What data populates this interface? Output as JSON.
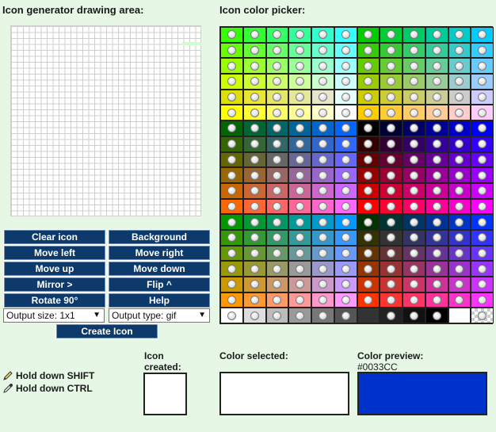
{
  "headings": {
    "drawing_area": "Icon generator drawing area:",
    "color_picker": "Icon color picker:"
  },
  "buttons": {
    "clear_icon": "Clear icon",
    "background": "Background",
    "move_left": "Move left",
    "move_right": "Move right",
    "move_up": "Move up",
    "move_down": "Move down",
    "mirror": "Mirror >",
    "flip": "Flip ^",
    "rotate": "Rotate 90°",
    "help": "Help",
    "create_icon": "Create Icon"
  },
  "selects": {
    "output_size": "Output size: 1x1",
    "output_type": "Output type: gif"
  },
  "hints": {
    "shift": "Hold down SHIFT",
    "ctrl": "Hold down CTRL"
  },
  "preview": {
    "icon_created_label": "Icon created:",
    "color_selected_label": "Color selected:",
    "color_preview_label": "Color preview:",
    "color_preview_value": "#0033CC"
  },
  "colors": {
    "page_bg": "#E6F7E6",
    "button_bg": "#0D3A6B",
    "preview_color": "#0033CC"
  },
  "palette": [
    [
      "#33FF00",
      "#33FF33",
      "#33FF66",
      "#33FF99",
      "#33FFCC",
      "#33FFFF",
      "#00CC00",
      "#00CC33",
      "#00CC66",
      "#00CC99",
      "#00CCCC",
      "#00CCFF"
    ],
    [
      "#66FF00",
      "#66FF33",
      "#66FF66",
      "#66FF99",
      "#66FFCC",
      "#66FFFF",
      "#33CC00",
      "#33CC33",
      "#33CC66",
      "#33CC99",
      "#33CCCC",
      "#33CCFF"
    ],
    [
      "#99FF00",
      "#99FF33",
      "#99FF66",
      "#99FF99",
      "#99FFCC",
      "#99FFFF",
      "#66CC00",
      "#66CC33",
      "#66CC66",
      "#66CC99",
      "#66CCCC",
      "#66CCFF"
    ],
    [
      "#CCFF00",
      "#CCFF33",
      "#CCFF66",
      "#CCFF99",
      "#CCFFCC",
      "#CCFFFF",
      "#99CC00",
      "#99CC33",
      "#99CC66",
      "#99CC99",
      "#99CCCC",
      "#99CCFF"
    ],
    [
      "#DDE000",
      "#E6E633",
      "#E6E666",
      "#E6E699",
      "#E6E6CC",
      "#E6FFFF",
      "#CCCC00",
      "#CCCC33",
      "#CCCC66",
      "#CCCC99",
      "#CCCCCC",
      "#CCCCFF"
    ],
    [
      "#FFFF00",
      "#FFFF33",
      "#FFFF66",
      "#FFFF99",
      "#FFFFCC",
      "#FFFFFF",
      "#FFCC00",
      "#FFCC33",
      "#FFCC66",
      "#FFCC99",
      "#FFCCCC",
      "#FFCCFF"
    ],
    [
      "#006600",
      "#006633",
      "#006666",
      "#006699",
      "#0066CC",
      "#0066FF",
      "#000000",
      "#000033",
      "#000066",
      "#000099",
      "#0000CC",
      "#0000FF"
    ],
    [
      "#336600",
      "#336633",
      "#336666",
      "#336699",
      "#3366CC",
      "#3366FF",
      "#330000",
      "#330033",
      "#330066",
      "#330099",
      "#3300CC",
      "#3300FF"
    ],
    [
      "#666600",
      "#666633",
      "#666666",
      "#666699",
      "#6666CC",
      "#6666FF",
      "#660000",
      "#660033",
      "#660066",
      "#660099",
      "#6600CC",
      "#6600FF"
    ],
    [
      "#996600",
      "#996633",
      "#996666",
      "#996699",
      "#9966CC",
      "#9966FF",
      "#990000",
      "#990033",
      "#990066",
      "#990099",
      "#9900CC",
      "#9900FF"
    ],
    [
      "#CC6600",
      "#CC6633",
      "#CC6666",
      "#CC6699",
      "#CC66CC",
      "#CC66FF",
      "#CC0000",
      "#CC0033",
      "#CC0066",
      "#CC0099",
      "#CC00CC",
      "#CC00FF"
    ],
    [
      "#FF6600",
      "#FF6633",
      "#FF6666",
      "#FF6699",
      "#FF66CC",
      "#FF66FF",
      "#FF0000",
      "#FF0033",
      "#FF0066",
      "#FF0099",
      "#FF00CC",
      "#FF00FF"
    ],
    [
      "#009900",
      "#009933",
      "#009966",
      "#009999",
      "#0099CC",
      "#0099FF",
      "#003300",
      "#003333",
      "#003366",
      "#003399",
      "#0033CC",
      "#0033FF"
    ],
    [
      "#339900",
      "#339933",
      "#339966",
      "#339999",
      "#3399CC",
      "#3399FF",
      "#333300",
      "#333333",
      "#333366",
      "#333399",
      "#3333CC",
      "#3333FF"
    ],
    [
      "#669900",
      "#669933",
      "#669966",
      "#669999",
      "#6699CC",
      "#6699FF",
      "#663300",
      "#663333",
      "#663366",
      "#663399",
      "#6633CC",
      "#6633FF"
    ],
    [
      "#999900",
      "#999933",
      "#999966",
      "#999999",
      "#9999CC",
      "#9999FF",
      "#993300",
      "#993333",
      "#993366",
      "#993399",
      "#9933CC",
      "#9933FF"
    ],
    [
      "#CC9900",
      "#CC9933",
      "#CC9966",
      "#CC9999",
      "#CC99CC",
      "#CC99FF",
      "#CC3300",
      "#CC3333",
      "#CC3366",
      "#CC3399",
      "#CC33CC",
      "#CC33FF"
    ],
    [
      "#FF9900",
      "#FF9933",
      "#FF9966",
      "#FF9999",
      "#FF99CC",
      "#FF99FF",
      "#FF3300",
      "#FF3333",
      "#FF3366",
      "#FF3399",
      "#FF33CC",
      "#FF33FF"
    ],
    [
      "#FFFFFF",
      "#DDDDDD",
      "#BBBBBB",
      "#999999",
      "#777777",
      "#555555",
      "#333333",
      "#222222",
      "#111111",
      "#000000",
      "#FFFFFF",
      "transparent"
    ]
  ]
}
